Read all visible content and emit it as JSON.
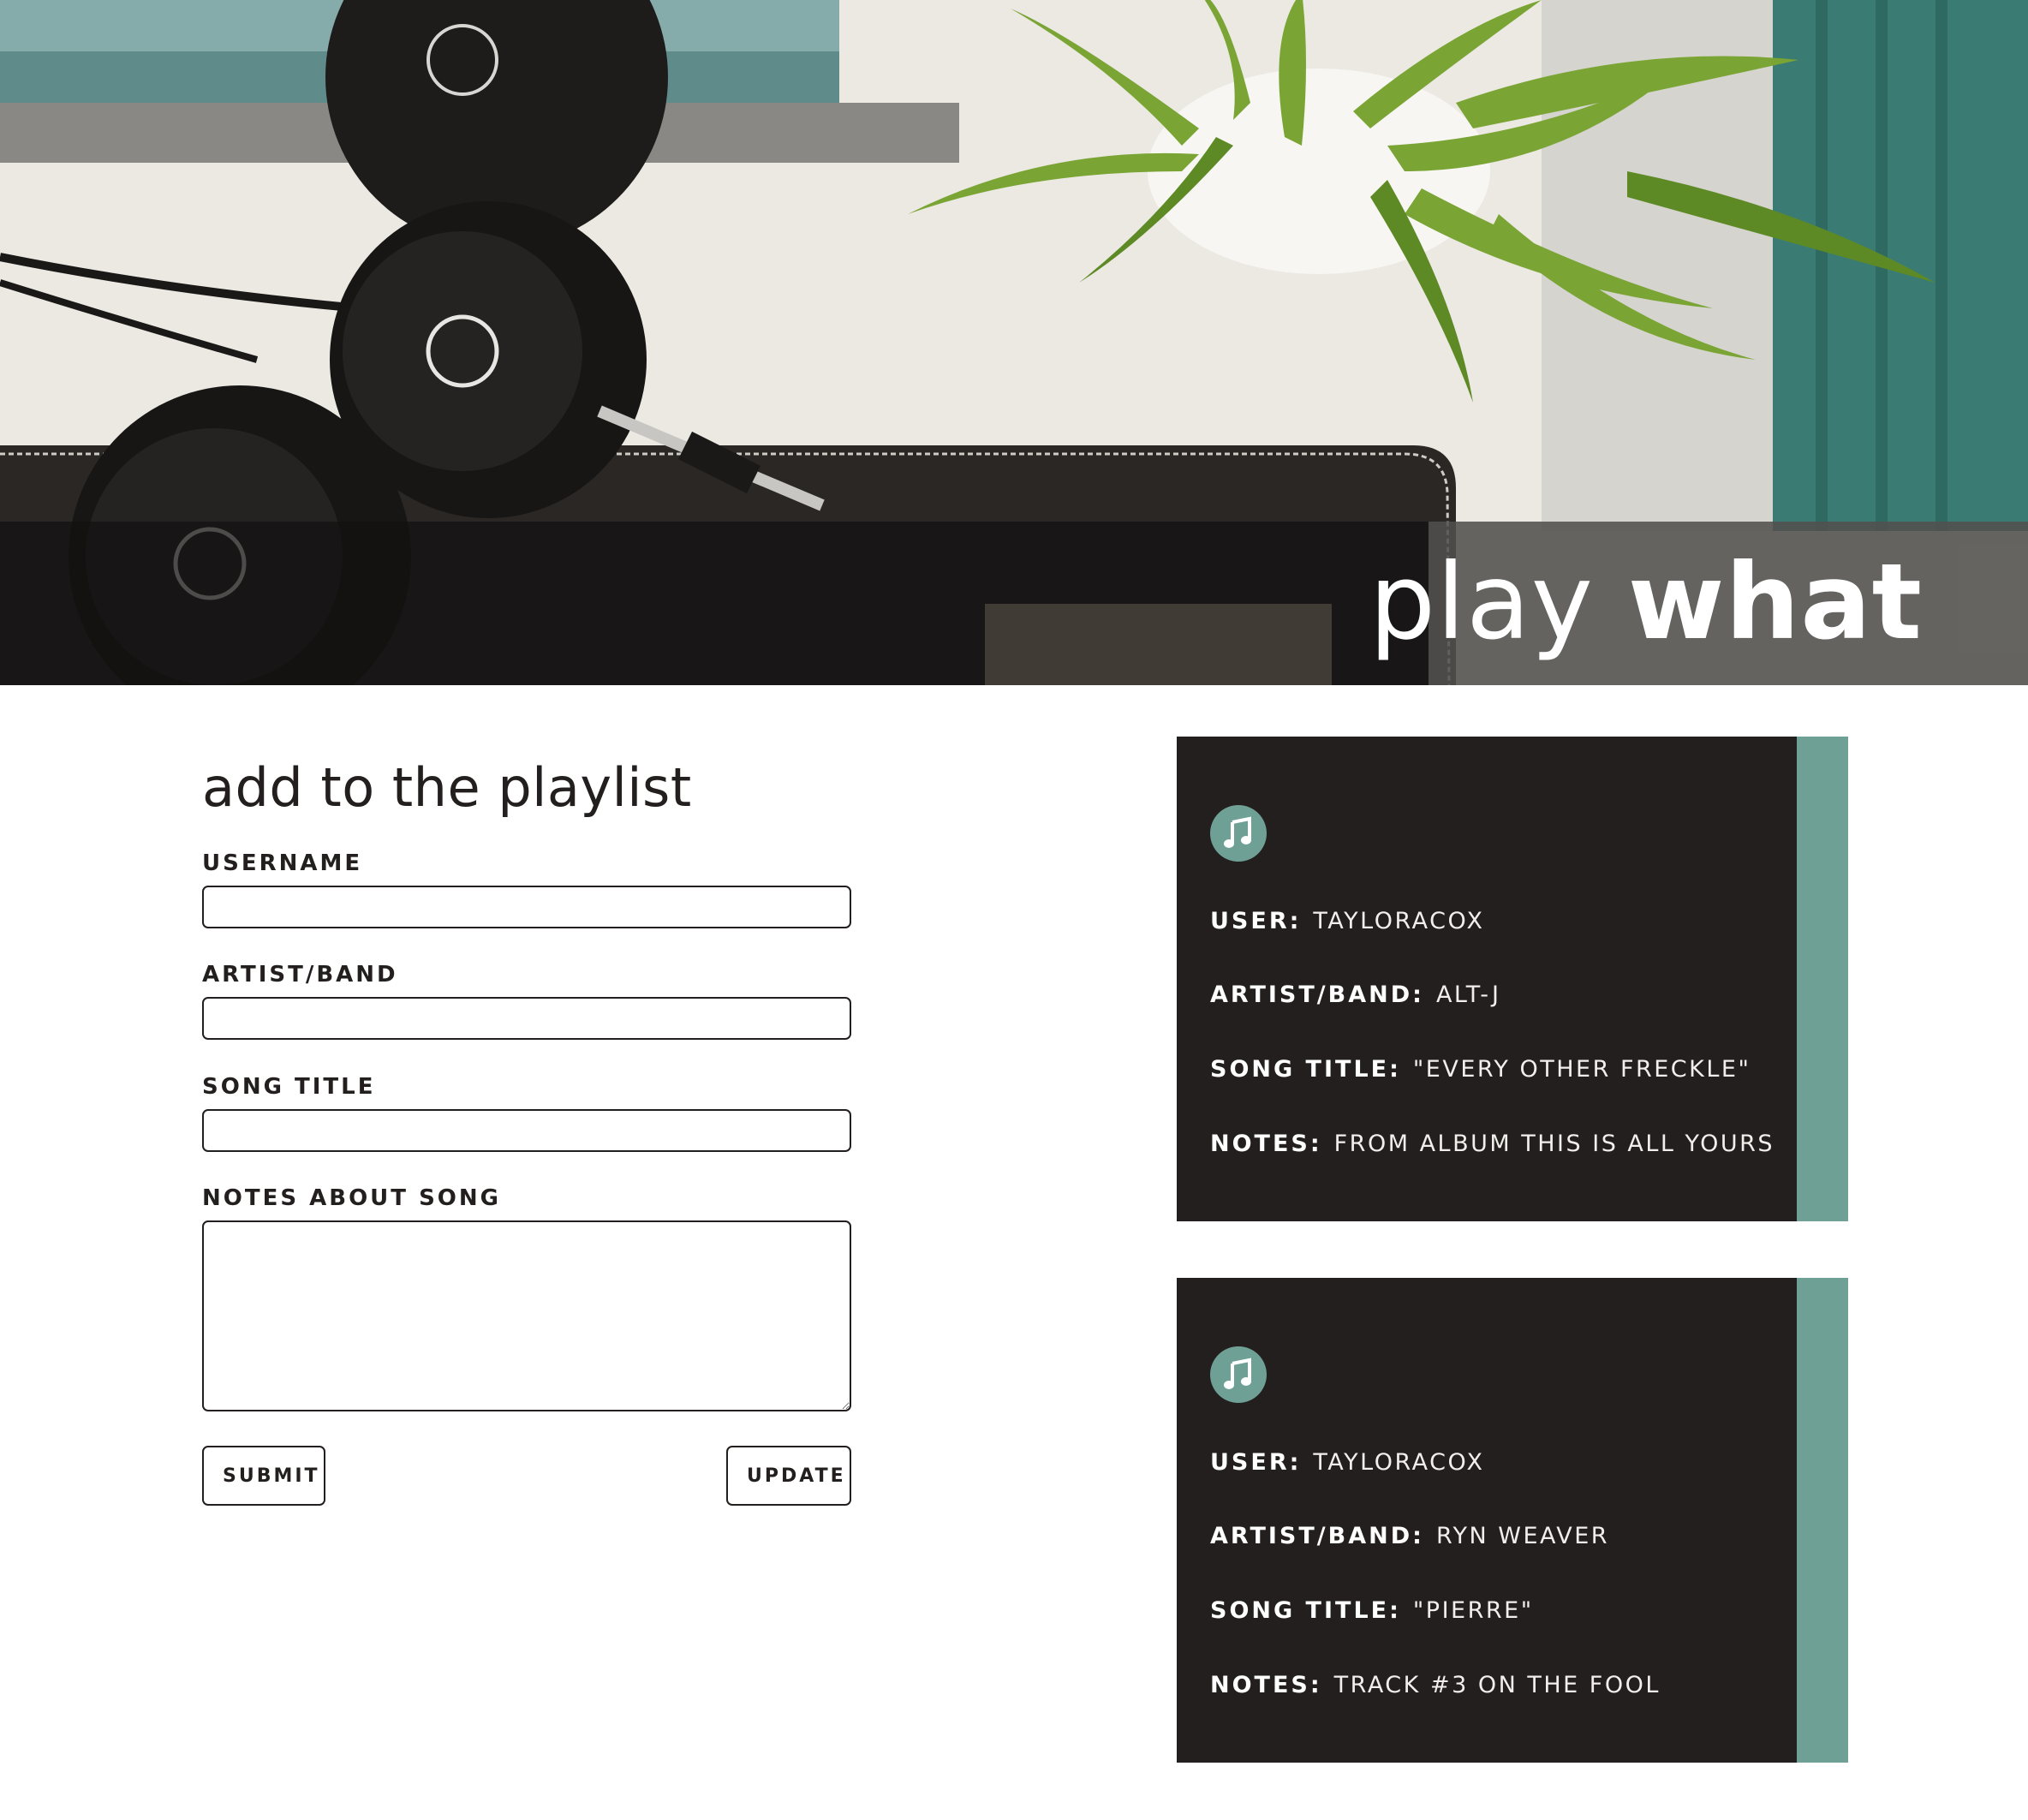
{
  "header": {
    "logo_light": "play",
    "logo_bold": "what"
  },
  "form": {
    "title": "add to the playlist",
    "username_label": "USERNAME",
    "username_value": "",
    "artist_label": "ARTIST/BAND",
    "artist_value": "",
    "song_label": "SONG TITLE",
    "song_value": "",
    "notes_label": "NOTES ABOUT SONG",
    "notes_value": "",
    "submit_label": "SUBMIT",
    "update_label": "UPDATE"
  },
  "playlist": [
    {
      "icon": "music-note-icon",
      "user_key": "USER:",
      "user": "TAYLORACOX",
      "artist_key": "ARTIST/BAND:",
      "artist": "ALT-J",
      "song_key": "SONG TITLE:",
      "song": "\"EVERY OTHER FRECKLE\"",
      "notes_key": "NOTES:",
      "notes": "FROM ALBUM THIS IS ALL YOURS"
    },
    {
      "icon": "music-note-icon",
      "user_key": "USER:",
      "user": "TAYLORACOX",
      "artist_key": "ARTIST/BAND:",
      "artist": "RYN WEAVER",
      "song_key": "SONG TITLE:",
      "song": "\"PIERRE\"",
      "notes_key": "NOTES:",
      "notes": "TRACK #3 ON THE FOOL"
    }
  ],
  "colors": {
    "card_bg": "#231f1e",
    "accent": "#6fa095",
    "text_dark": "#231f1e"
  }
}
